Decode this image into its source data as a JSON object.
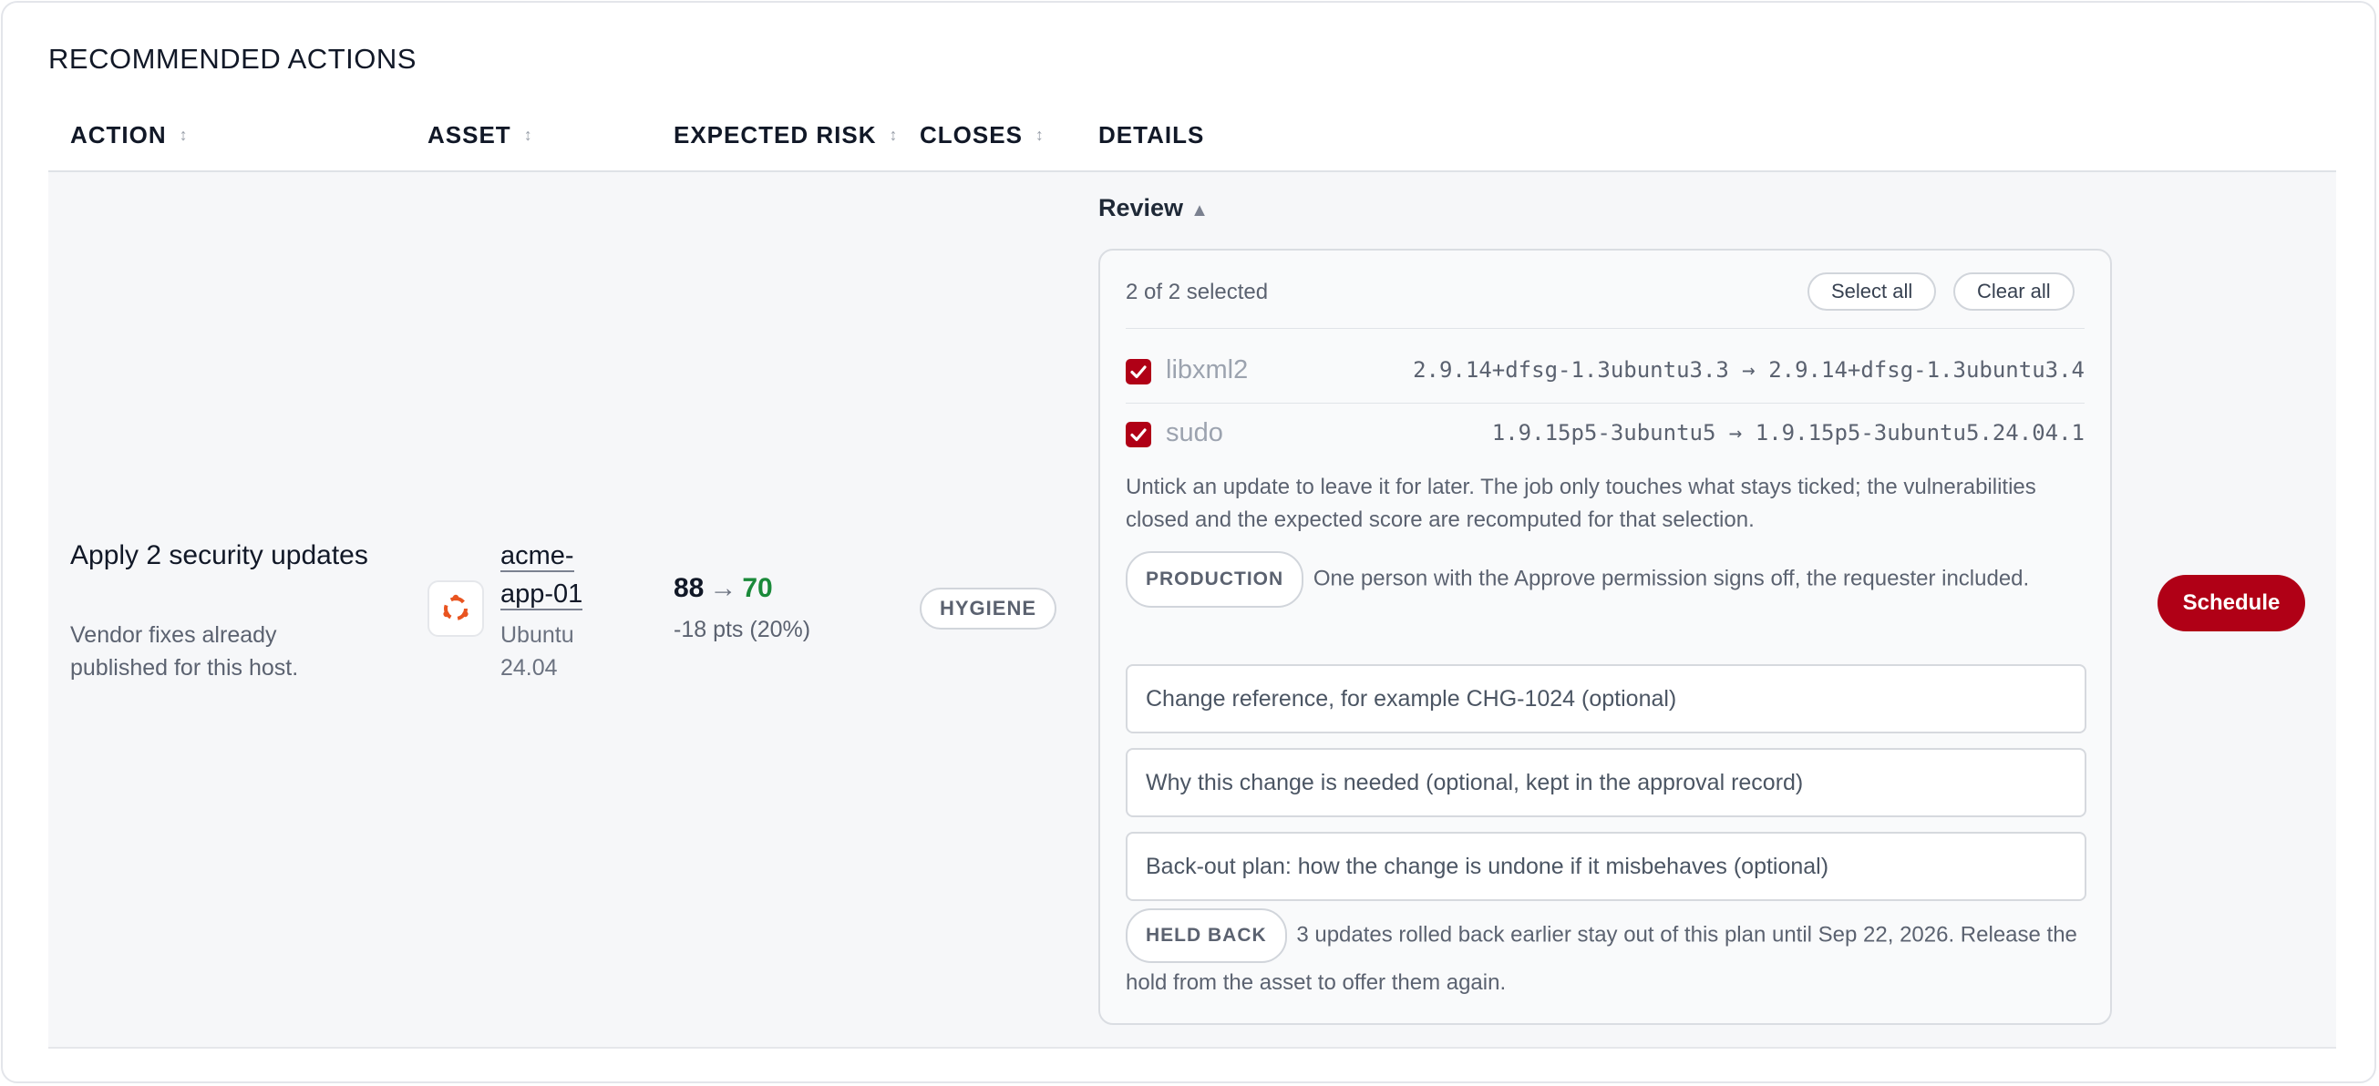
{
  "section": {
    "title": "RECOMMENDED ACTIONS"
  },
  "columns": {
    "action": "ACTION",
    "asset": "ASSET",
    "expected_risk": "EXPECTED RISK",
    "closes": "CLOSES",
    "details": "DETAILS"
  },
  "row": {
    "action_title": "Apply 2 security updates",
    "action_subtitle": "Vendor fixes already published for this host.",
    "asset_name": "acme-app-01",
    "asset_os": "Ubuntu 24.04",
    "risk_from": "88",
    "risk_to": "70",
    "risk_delta": "-18 pts (20%)",
    "closes_badge": "HYGIENE",
    "review_label": "Review",
    "selected_count": "2 of 2 selected",
    "select_all": "Select all",
    "clear_all": "Clear all",
    "packages": [
      {
        "name": "libxml2",
        "version": "2.9.14+dfsg-1.3ubuntu3.3 → 2.9.14+dfsg-1.3ubuntu3.4",
        "checked": true
      },
      {
        "name": "sudo",
        "version": "1.9.15p5-3ubuntu5 → 1.9.15p5-3ubuntu5.24.04.1",
        "checked": true
      }
    ],
    "untick_note": "Untick an update to leave it for later. The job only touches what stays ticked; the vulnerabilities closed and the expected score are recomputed for that selection.",
    "env_badge": "PRODUCTION",
    "env_note": "One person with the Approve permission signs off, the requester included.",
    "change_ref_placeholder": "Change reference, for example CHG-1024 (optional)",
    "reason_placeholder": "Why this change is needed (optional, kept in the approval record)",
    "backout_placeholder": "Back-out plan: how the change is undone if it misbehaves (optional)",
    "held_badge": "HELD BACK",
    "held_note": "3 updates rolled back earlier stay out of this plan until Sep 22, 2026. Release the hold from the asset to offer them again.",
    "schedule_label": "Schedule"
  },
  "icons": {
    "sort": "sort-arrows-icon",
    "review_toggle": "triangle-up-icon",
    "asset": "ubuntu-logo-icon",
    "checkbox": "checkmark-icon"
  },
  "colors": {
    "accent": "#b00016",
    "risk_improved": "#1a8a3a",
    "ubuntu": "#e95420"
  }
}
